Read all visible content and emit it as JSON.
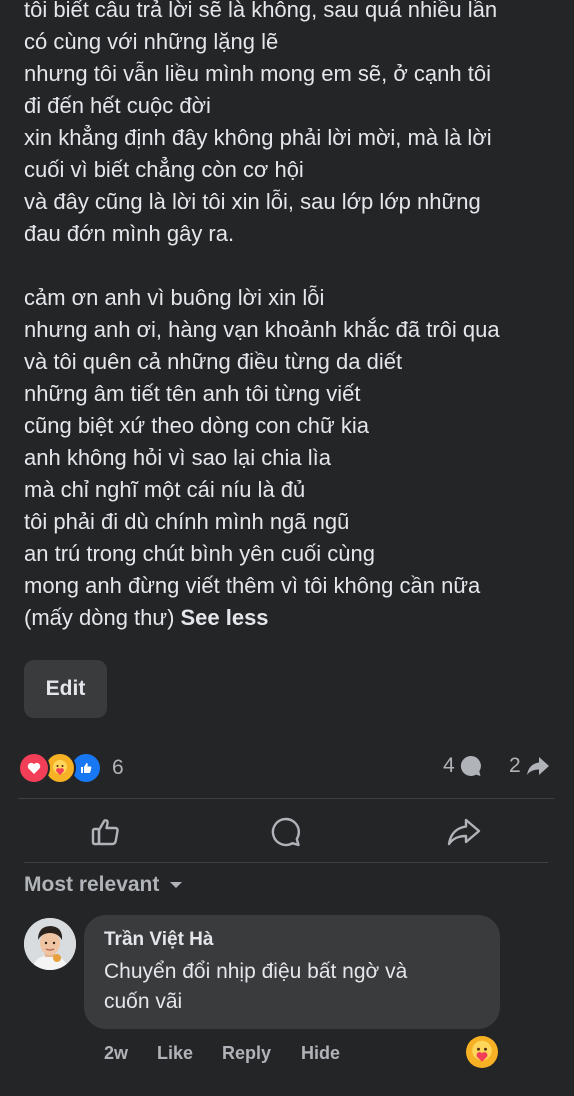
{
  "post": {
    "lines": [
      "tôi biết câu trả lời sẽ là không, sau quá nhiều lần",
      "có cùng với những lặng lẽ",
      "nhưng tôi vẫn liều mình mong em sẽ, ở cạnh tôi",
      "đi đến hết cuộc đời",
      "xin khẳng định đây không phải lời mời, mà là lời",
      "cuối vì biết chẳng còn cơ hội",
      "và đây cũng là lời tôi xin lỗi, sau lớp lớp những",
      "đau đớn mình gây ra.",
      "",
      "cảm ơn anh vì buông lời xin lỗi",
      "nhưng anh ơi, hàng vạn khoảnh khắc đã trôi qua",
      "và tôi quên cả những điều từng da diết",
      "những âm tiết tên anh tôi từng viết",
      "cũng biệt xứ theo dòng con chữ kia",
      "anh không hỏi vì sao lại chia lìa",
      "mà chỉ nghĩ một cái níu là đủ",
      "tôi phải đi dù chính mình ngã ngũ",
      "an trú trong chút bình yên cuối cùng",
      "mong anh đừng viết thêm vì tôi không cần nữa"
    ],
    "last_line": "(mấy dòng thư)",
    "see_less": "See less",
    "edit_label": "Edit"
  },
  "stats": {
    "reaction_count": "6",
    "comment_count": "4",
    "share_count": "2",
    "reaction_icons": [
      "love-icon",
      "care-icon",
      "like-icon"
    ]
  },
  "comments": {
    "sort_label": "Most relevant",
    "items": [
      {
        "author": "Trần Việt Hà",
        "text_lines": [
          "Chuyển đổi nhịp điệu bất ngờ và",
          "cuốn vãi"
        ],
        "time": "2w",
        "like": "Like",
        "reply": "Reply",
        "hide": "Hide",
        "reaction_icon": "care-icon"
      }
    ]
  },
  "colors": {
    "background": "#242526",
    "text": "#e4e6eb",
    "secondary_text": "#b0b3b8",
    "button_bg": "#3a3b3c",
    "love": "#f33e58",
    "care": "#f7b125",
    "like": "#1877f2"
  }
}
